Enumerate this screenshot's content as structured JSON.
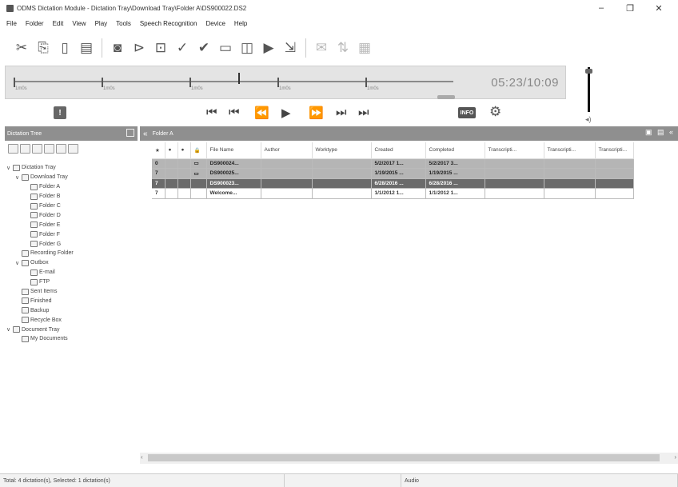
{
  "window": {
    "title": "ODMS Dictation Module - Dictation Tray\\Download Tray\\Folder A\\DS900022.DS2",
    "controls": [
      "–",
      "❐",
      "✕"
    ]
  },
  "menu": [
    "File",
    "Folder",
    "Edit",
    "View",
    "Play",
    "Tools",
    "Speech Recognition",
    "Device",
    "Help"
  ],
  "toolbar": {
    "icons": [
      "cut-icon",
      "copy-icon",
      "paste-icon",
      "new-file-icon",
      "record-icon",
      "send-icon",
      "import-icon",
      "check-icon",
      "finish-check-icon",
      "compose-icon",
      "voice-recognize-icon",
      "play-stop-icon",
      "transfer-icon",
      "email-icon",
      "ftp-icon",
      "settings-doc-icon"
    ]
  },
  "player": {
    "time": "05:23/10:09",
    "seek_progress": 0.51,
    "seek_labels": [
      "1m0s",
      "1m0s",
      "1m0s",
      "1m0s",
      "1m0s"
    ]
  },
  "volume": {
    "level": 0.9,
    "icon": "speaker-icon",
    "icon_glyph": "◂)"
  },
  "transport": {
    "alert_label": "!",
    "info_label": "INFO",
    "settings_glyph": "⚙",
    "buttons": [
      {
        "name": "goto-start-button",
        "glyph": "⏮"
      },
      {
        "name": "goto-start-2-button",
        "glyph": "⏮"
      },
      {
        "name": "rewind-button",
        "glyph": "⏪"
      },
      {
        "name": "play-button",
        "glyph": "▶"
      },
      {
        "name": "fast-forward-button",
        "glyph": "⏩"
      },
      {
        "name": "goto-end-2-button",
        "glyph": "⏭"
      },
      {
        "name": "goto-end-button",
        "glyph": "⏭"
      }
    ]
  },
  "tree": {
    "header": "Dictation Tree",
    "nodes": [
      {
        "label": "Dictation Tray",
        "level": 0,
        "expander": "∨"
      },
      {
        "label": "Download Tray",
        "level": 1,
        "expander": "∨"
      },
      {
        "label": "Folder A",
        "level": 2,
        "expander": ""
      },
      {
        "label": "Folder B",
        "level": 2,
        "expander": ""
      },
      {
        "label": "Folder C",
        "level": 2,
        "expander": ""
      },
      {
        "label": "Folder D",
        "level": 2,
        "expander": ""
      },
      {
        "label": "Folder E",
        "level": 2,
        "expander": ""
      },
      {
        "label": "Folder F",
        "level": 2,
        "expander": ""
      },
      {
        "label": "Folder G",
        "level": 2,
        "expander": ""
      },
      {
        "label": "Recording Folder",
        "level": 1,
        "expander": ""
      },
      {
        "label": "Outbox",
        "level": 1,
        "expander": "∨"
      },
      {
        "label": "E-mail",
        "level": 2,
        "expander": ""
      },
      {
        "label": "FTP",
        "level": 2,
        "expander": ""
      },
      {
        "label": "Sent Items",
        "level": 1,
        "expander": ""
      },
      {
        "label": "Finished",
        "level": 1,
        "expander": ""
      },
      {
        "label": "Backup",
        "level": 1,
        "expander": ""
      },
      {
        "label": "Recycle Box",
        "level": 1,
        "expander": ""
      },
      {
        "label": "Document Tray",
        "level": 0,
        "expander": "∨"
      },
      {
        "label": "My Documents",
        "level": 1,
        "expander": ""
      }
    ]
  },
  "list": {
    "header": "Folder A",
    "columns": [
      "★",
      "●",
      "●",
      "🔒",
      "File Name",
      "Author",
      "Worktype",
      "Created",
      "Completed",
      "Transcripti...",
      "Transcripti...",
      "Transcripti..."
    ],
    "rows": [
      {
        "style": "grey",
        "cells": [
          "0",
          "",
          "",
          "▭",
          "DS900024...",
          "",
          "",
          "5/2/2017 1...",
          "5/2/2017 3...",
          "",
          "",
          ""
        ]
      },
      {
        "style": "grey",
        "cells": [
          "7",
          "",
          "",
          "▭",
          "DS900025...",
          "",
          "",
          "1/19/2015 ...",
          "1/19/2015 ...",
          "",
          "",
          ""
        ]
      },
      {
        "style": "sel",
        "cells": [
          "7",
          "",
          "",
          "",
          "DS900023...",
          "",
          "",
          "6/28/2016 ...",
          "6/28/2016 ...",
          "",
          "",
          ""
        ]
      },
      {
        "style": "white",
        "cells": [
          "7",
          "",
          "",
          "",
          "Welcome...",
          "",
          "",
          "1/1/2012 1...",
          "1/1/2012 1...",
          "",
          "",
          ""
        ]
      }
    ]
  },
  "status": {
    "left": "Total: 4 dictation(s), Selected: 1 dictation(s)",
    "middle": "",
    "audio": "Audio"
  }
}
